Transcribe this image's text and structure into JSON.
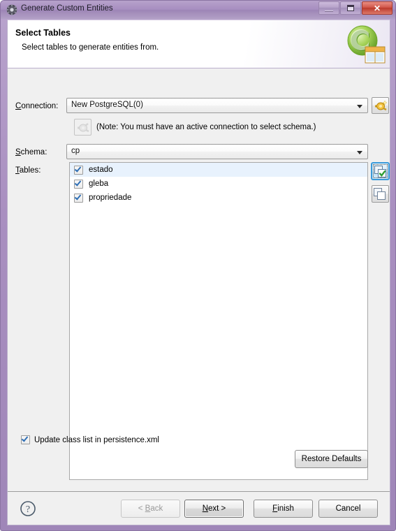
{
  "window": {
    "title": "Generate Custom Entities",
    "icon": "gear-icon",
    "minimize_label": "Minimize",
    "maximize_label": "Maximize",
    "close_label": "Close",
    "close_glyph": "✕"
  },
  "banner": {
    "title": "Select Tables",
    "subtitle": "Select tables to generate entities from.",
    "icon": "database-table-logo-icon"
  },
  "form": {
    "connection_label": "Connection:",
    "connection_mnemonic": "C",
    "connection_value": "New PostgreSQL(0)",
    "new_connection_button": "new-connection-icon",
    "note_button": "reconnect-icon-disabled",
    "note_text": "(Note: You must have an active connection to select schema.)",
    "schema_label": "Schema:",
    "schema_mnemonic": "S",
    "schema_value": "cp",
    "tables_label": "Tables:",
    "tables_mnemonic": "T"
  },
  "tables": {
    "items": [
      {
        "label": "estado",
        "checked": true,
        "selected": true
      },
      {
        "label": "gleba",
        "checked": true,
        "selected": false
      },
      {
        "label": "propriedade",
        "checked": true,
        "selected": false
      }
    ],
    "select_all_button": "select-all-icon",
    "deselect_all_button": "deselect-all-icon"
  },
  "options": {
    "update_class_list_label": "Update class list in persistence.xml",
    "update_class_list_checked": true,
    "restore_defaults_label": "Restore Defaults"
  },
  "footer": {
    "help_label": "?",
    "back_label": "< Back",
    "back_mnemonic": "B",
    "next_label": "Next >",
    "next_mnemonic": "N",
    "finish_label": "Finish",
    "finish_mnemonic": "F",
    "cancel_label": "Cancel"
  },
  "colors": {
    "titlebar": "#a98fc0",
    "close_button": "#c9453a",
    "selection": "#e8f2fd",
    "checkmark": "#2f6fb5",
    "focus_border": "#3a9ad9",
    "logo_green": "#8cc63f"
  }
}
